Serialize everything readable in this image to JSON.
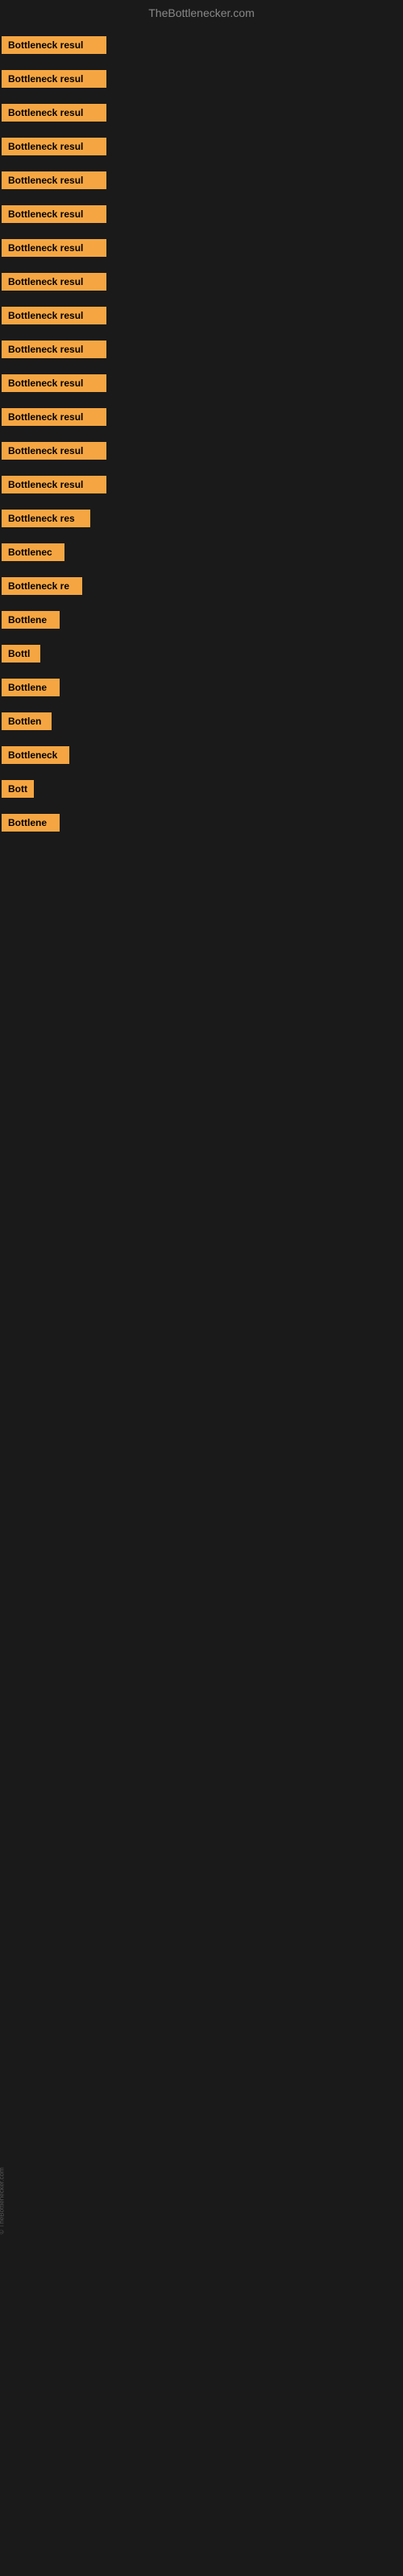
{
  "header": {
    "title": "TheBottlenecker.com"
  },
  "results": [
    {
      "label": "Bottleneck result",
      "width": 130,
      "visible_chars": 16
    },
    {
      "label": "Bottleneck result",
      "width": 130,
      "visible_chars": 16
    },
    {
      "label": "Bottleneck result",
      "width": 130,
      "visible_chars": 16
    },
    {
      "label": "Bottleneck result",
      "width": 130,
      "visible_chars": 16
    },
    {
      "label": "Bottleneck result",
      "width": 130,
      "visible_chars": 16
    },
    {
      "label": "Bottleneck result",
      "width": 130,
      "visible_chars": 16
    },
    {
      "label": "Bottleneck result",
      "width": 130,
      "visible_chars": 16
    },
    {
      "label": "Bottleneck result",
      "width": 130,
      "visible_chars": 16
    },
    {
      "label": "Bottleneck result",
      "width": 130,
      "visible_chars": 16
    },
    {
      "label": "Bottleneck result",
      "width": 130,
      "visible_chars": 16
    },
    {
      "label": "Bottleneck result",
      "width": 130,
      "visible_chars": 16
    },
    {
      "label": "Bottleneck result",
      "width": 130,
      "visible_chars": 16
    },
    {
      "label": "Bottleneck result",
      "width": 130,
      "visible_chars": 16
    },
    {
      "label": "Bottleneck result",
      "width": 130,
      "visible_chars": 16
    },
    {
      "label": "Bottleneck res",
      "width": 110,
      "visible_chars": 14
    },
    {
      "label": "Bottlenec",
      "width": 78,
      "visible_chars": 9
    },
    {
      "label": "Bottleneck re",
      "width": 100,
      "visible_chars": 13
    },
    {
      "label": "Bottlene",
      "width": 72,
      "visible_chars": 8
    },
    {
      "label": "Bottl",
      "width": 48,
      "visible_chars": 5
    },
    {
      "label": "Bottlene",
      "width": 72,
      "visible_chars": 8
    },
    {
      "label": "Bottlen",
      "width": 62,
      "visible_chars": 7
    },
    {
      "label": "Bottleneck",
      "width": 84,
      "visible_chars": 10
    },
    {
      "label": "Bott",
      "width": 40,
      "visible_chars": 4
    },
    {
      "label": "Bottlene",
      "width": 72,
      "visible_chars": 8
    }
  ],
  "watermark": {
    "text": "© TheBottlenecker.com"
  }
}
